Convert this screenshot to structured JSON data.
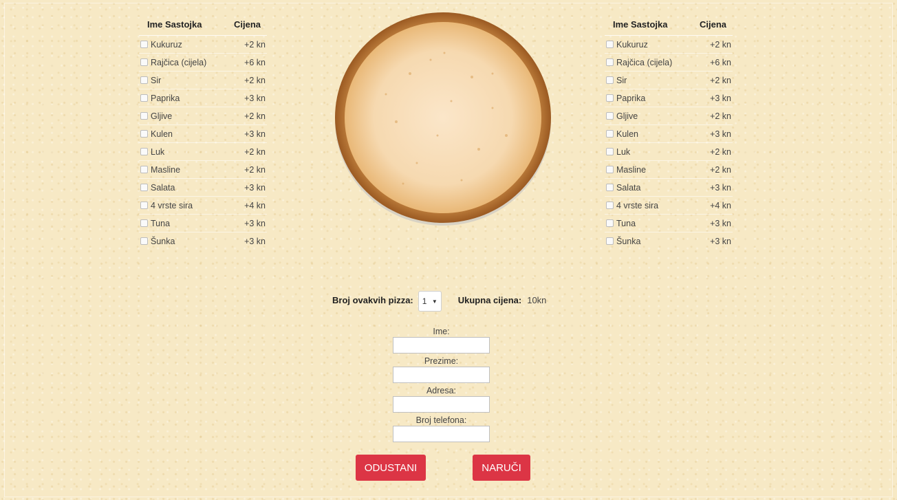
{
  "headers": {
    "name": "Ime Sastojka",
    "price": "Cijena"
  },
  "ingredients": [
    {
      "name": "Kukuruz",
      "price": "+2 kn"
    },
    {
      "name": "Rajčica (cijela)",
      "price": "+6 kn"
    },
    {
      "name": "Sir",
      "price": "+2 kn"
    },
    {
      "name": "Paprika",
      "price": "+3 kn"
    },
    {
      "name": "Gljive",
      "price": "+2 kn"
    },
    {
      "name": "Kulen",
      "price": "+3 kn"
    },
    {
      "name": "Luk",
      "price": "+2 kn"
    },
    {
      "name": "Masline",
      "price": "+2 kn"
    },
    {
      "name": "Salata",
      "price": "+3 kn"
    },
    {
      "name": "4 vrste sira",
      "price": "+4 kn"
    },
    {
      "name": "Tuna",
      "price": "+3 kn"
    },
    {
      "name": "Šunka",
      "price": "+3 kn"
    }
  ],
  "order": {
    "quantity_label": "Broj ovakvih pizza:",
    "quantity_value": "1",
    "total_label": "Ukupna cijena:",
    "total_value": "10kn"
  },
  "form": {
    "first_name_label": "Ime:",
    "last_name_label": "Prezime:",
    "address_label": "Adresa:",
    "phone_label": "Broj telefona:"
  },
  "buttons": {
    "cancel": "ODUSTANI",
    "order": "NARUČI"
  },
  "colors": {
    "accent": "#dc3545",
    "background": "#f7e9c5"
  }
}
